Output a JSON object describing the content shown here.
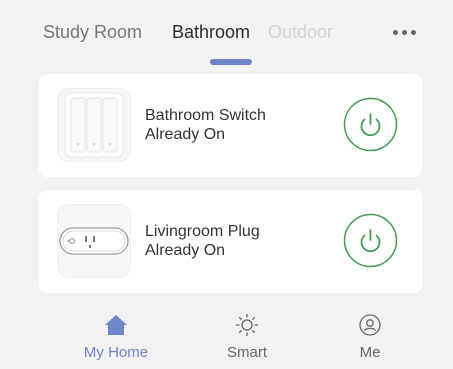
{
  "tabs": {
    "items": [
      "Study Room",
      "Bathroom",
      "Outdoor"
    ],
    "active_index": 1,
    "more_icon": "more-dots-icon"
  },
  "devices": [
    {
      "name": "Bathroom Switch",
      "status": "Already On",
      "thumbnail_icon": "wall-switch-icon",
      "power_icon": "power-icon",
      "power_on": true
    },
    {
      "name": "Livingroom Plug",
      "status": "Already On",
      "thumbnail_icon": "power-strip-icon",
      "power_icon": "power-icon",
      "power_on": true
    }
  ],
  "bottom_nav": {
    "items": [
      {
        "label": "My Home",
        "icon": "home-icon",
        "active": true
      },
      {
        "label": "Smart",
        "icon": "sun-icon",
        "active": false
      },
      {
        "label": "Me",
        "icon": "user-icon",
        "active": false
      }
    ]
  },
  "colors": {
    "background": "#f2f2f2",
    "card": "#ffffff",
    "accent": "#6f86c9",
    "power_green": "#3f9e52",
    "text_primary": "#333333",
    "text_inactive": "#777777",
    "tab_disabled": "#d2d2d2"
  }
}
